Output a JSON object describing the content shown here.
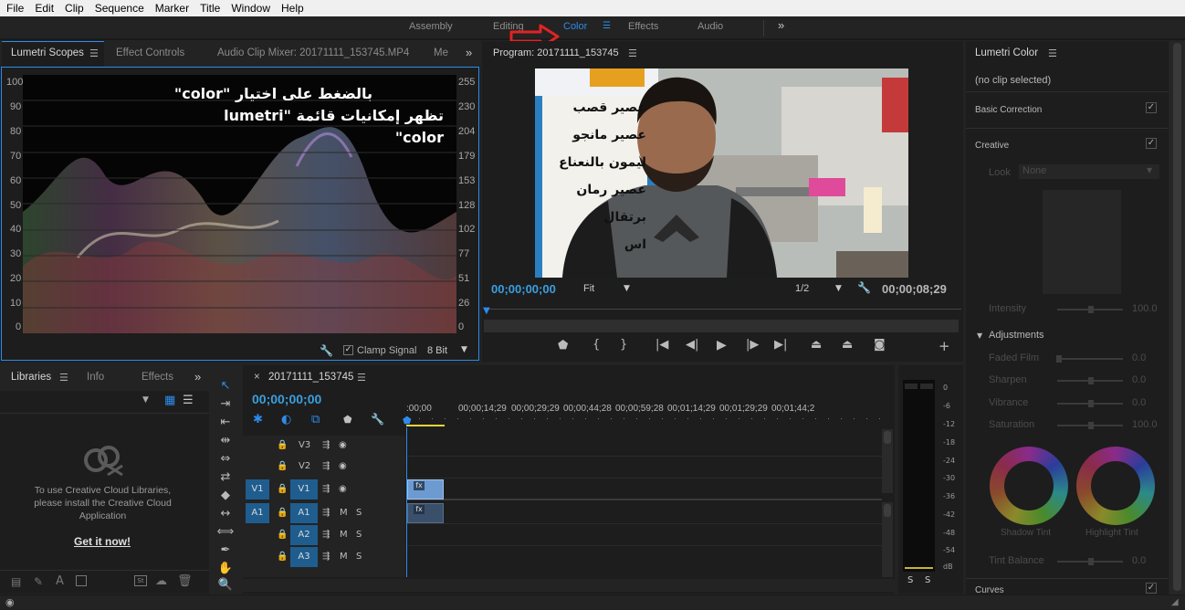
{
  "menu": [
    "File",
    "Edit",
    "Clip",
    "Sequence",
    "Marker",
    "Title",
    "Window",
    "Help"
  ],
  "workspaces": {
    "assembly": "Assembly",
    "editing": "Editing",
    "color": "Color",
    "effects": "Effects",
    "audio": "Audio",
    "overflow": "»"
  },
  "colors": {
    "accent": "#2d8ceb",
    "arrow": "#e32222",
    "timecode": "#3a9fe0",
    "clip_video": "#6d9bd1",
    "clip_audio": "#3a4f6a",
    "track_target": "#1f5d8f"
  },
  "source_panel": {
    "tabs": [
      "Lumetri Scopes",
      "Effect Controls",
      "Audio Clip Mixer: 20171111_153745.MP4",
      "Me"
    ],
    "overflow": "»",
    "left_axis": [
      "100",
      "90",
      "80",
      "70",
      "60",
      "50",
      "40",
      "30",
      "20",
      "10",
      "0"
    ],
    "right_axis": [
      "255",
      "230",
      "204",
      "179",
      "153",
      "128",
      "102",
      "77",
      "51",
      "26",
      "0"
    ],
    "clamp_signal": "Clamp Signal",
    "bit_depth": "8 Bit",
    "annotation_line1": "بالضغط على اختيار \"color\"",
    "annotation_line2": "تظهر إمكانيات قائمة \"lumetri color\""
  },
  "program": {
    "title": "Program: 20171111_153745",
    "timecode_left": "00;00;00;00",
    "fit": "Fit",
    "resolution": "1/2",
    "timecode_right": "00;00;08;29",
    "sign_lines": [
      "عصير قصب",
      "عصير مانجو",
      "ليمون بالنعناع",
      "عصير رمان",
      "برتقال",
      "اس"
    ]
  },
  "lumetri_color": {
    "title": "Lumetri Color",
    "clip_status": "(no clip selected)",
    "basic_correction": "Basic Correction",
    "creative": "Creative",
    "look_label": "Look",
    "look_value": "None",
    "intensity": {
      "label": "Intensity",
      "value": "100.0"
    },
    "adjustments": "Adjustments",
    "faded_film": {
      "label": "Faded Film",
      "value": "0.0"
    },
    "sharpen": {
      "label": "Sharpen",
      "value": "0.0"
    },
    "vibrance": {
      "label": "Vibrance",
      "value": "0.0"
    },
    "saturation": {
      "label": "Saturation",
      "value": "100.0"
    },
    "shadow_tint": "Shadow Tint",
    "highlight_tint": "Highlight Tint",
    "tint_balance": {
      "label": "Tint Balance",
      "value": "0.0"
    },
    "curves": "Curves"
  },
  "libraries": {
    "tabs": [
      "Libraries",
      "Info",
      "Effects"
    ],
    "overflow": "»",
    "message": "To use Creative Cloud Libraries, please install the Creative Cloud Application",
    "link": "Get it now!"
  },
  "timeline": {
    "sequence_name": "20171111_153745",
    "timecode": "00;00;00;00",
    "ruler": [
      ":00;00",
      "00;00;14;29",
      "00;00;29;29",
      "00;00;44;28",
      "00;00;59;28",
      "00;01;14;29",
      "00;01;29;29",
      "00;01;44;2"
    ],
    "tracks": [
      {
        "name": "V3",
        "target": "",
        "btn1": "",
        "btn2": ""
      },
      {
        "name": "V2",
        "target": "",
        "btn1": "",
        "btn2": ""
      },
      {
        "name": "V1",
        "target": "V1",
        "btn1": "",
        "btn2": ""
      },
      {
        "name": "A1",
        "target": "A1",
        "btn1": "M",
        "btn2": "S"
      },
      {
        "name": "A2",
        "target": "",
        "btn1": "M",
        "btn2": "S"
      },
      {
        "name": "A3",
        "target": "",
        "btn1": "M",
        "btn2": "S"
      }
    ],
    "clip_fx": "fx"
  },
  "audio_meter": {
    "scale": [
      "0",
      "-6",
      "-12",
      "-18",
      "-24",
      "-30",
      "-36",
      "-42",
      "-48",
      "-54",
      "dB"
    ],
    "solo_left": "S",
    "solo_right": "S"
  }
}
